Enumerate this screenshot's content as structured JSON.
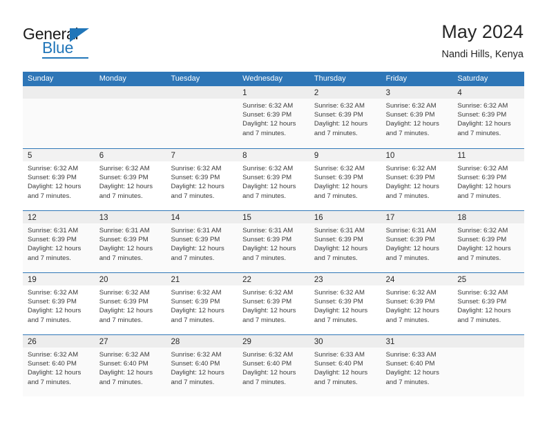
{
  "logo": {
    "word_top": "General",
    "word_bottom": "Blue",
    "triangle_icon": "blue-triangle-icon",
    "accent_color": "#2176b9"
  },
  "header": {
    "title": "May 2024",
    "location": "Nandi Hills, Kenya"
  },
  "calendar": {
    "header_bg": "#2e76b7",
    "day_names": [
      "Sunday",
      "Monday",
      "Tuesday",
      "Wednesday",
      "Thursday",
      "Friday",
      "Saturday"
    ],
    "weeks": [
      [
        {
          "date": "",
          "lines": []
        },
        {
          "date": "",
          "lines": []
        },
        {
          "date": "",
          "lines": []
        },
        {
          "date": "1",
          "lines": [
            "Sunrise: 6:32 AM",
            "Sunset: 6:39 PM",
            "Daylight: 12 hours",
            "and 7 minutes."
          ]
        },
        {
          "date": "2",
          "lines": [
            "Sunrise: 6:32 AM",
            "Sunset: 6:39 PM",
            "Daylight: 12 hours",
            "and 7 minutes."
          ]
        },
        {
          "date": "3",
          "lines": [
            "Sunrise: 6:32 AM",
            "Sunset: 6:39 PM",
            "Daylight: 12 hours",
            "and 7 minutes."
          ]
        },
        {
          "date": "4",
          "lines": [
            "Sunrise: 6:32 AM",
            "Sunset: 6:39 PM",
            "Daylight: 12 hours",
            "and 7 minutes."
          ]
        }
      ],
      [
        {
          "date": "5",
          "lines": [
            "Sunrise: 6:32 AM",
            "Sunset: 6:39 PM",
            "Daylight: 12 hours",
            "and 7 minutes."
          ]
        },
        {
          "date": "6",
          "lines": [
            "Sunrise: 6:32 AM",
            "Sunset: 6:39 PM",
            "Daylight: 12 hours",
            "and 7 minutes."
          ]
        },
        {
          "date": "7",
          "lines": [
            "Sunrise: 6:32 AM",
            "Sunset: 6:39 PM",
            "Daylight: 12 hours",
            "and 7 minutes."
          ]
        },
        {
          "date": "8",
          "lines": [
            "Sunrise: 6:32 AM",
            "Sunset: 6:39 PM",
            "Daylight: 12 hours",
            "and 7 minutes."
          ]
        },
        {
          "date": "9",
          "lines": [
            "Sunrise: 6:32 AM",
            "Sunset: 6:39 PM",
            "Daylight: 12 hours",
            "and 7 minutes."
          ]
        },
        {
          "date": "10",
          "lines": [
            "Sunrise: 6:32 AM",
            "Sunset: 6:39 PM",
            "Daylight: 12 hours",
            "and 7 minutes."
          ]
        },
        {
          "date": "11",
          "lines": [
            "Sunrise: 6:32 AM",
            "Sunset: 6:39 PM",
            "Daylight: 12 hours",
            "and 7 minutes."
          ]
        }
      ],
      [
        {
          "date": "12",
          "lines": [
            "Sunrise: 6:31 AM",
            "Sunset: 6:39 PM",
            "Daylight: 12 hours",
            "and 7 minutes."
          ]
        },
        {
          "date": "13",
          "lines": [
            "Sunrise: 6:31 AM",
            "Sunset: 6:39 PM",
            "Daylight: 12 hours",
            "and 7 minutes."
          ]
        },
        {
          "date": "14",
          "lines": [
            "Sunrise: 6:31 AM",
            "Sunset: 6:39 PM",
            "Daylight: 12 hours",
            "and 7 minutes."
          ]
        },
        {
          "date": "15",
          "lines": [
            "Sunrise: 6:31 AM",
            "Sunset: 6:39 PM",
            "Daylight: 12 hours",
            "and 7 minutes."
          ]
        },
        {
          "date": "16",
          "lines": [
            "Sunrise: 6:31 AM",
            "Sunset: 6:39 PM",
            "Daylight: 12 hours",
            "and 7 minutes."
          ]
        },
        {
          "date": "17",
          "lines": [
            "Sunrise: 6:31 AM",
            "Sunset: 6:39 PM",
            "Daylight: 12 hours",
            "and 7 minutes."
          ]
        },
        {
          "date": "18",
          "lines": [
            "Sunrise: 6:32 AM",
            "Sunset: 6:39 PM",
            "Daylight: 12 hours",
            "and 7 minutes."
          ]
        }
      ],
      [
        {
          "date": "19",
          "lines": [
            "Sunrise: 6:32 AM",
            "Sunset: 6:39 PM",
            "Daylight: 12 hours",
            "and 7 minutes."
          ]
        },
        {
          "date": "20",
          "lines": [
            "Sunrise: 6:32 AM",
            "Sunset: 6:39 PM",
            "Daylight: 12 hours",
            "and 7 minutes."
          ]
        },
        {
          "date": "21",
          "lines": [
            "Sunrise: 6:32 AM",
            "Sunset: 6:39 PM",
            "Daylight: 12 hours",
            "and 7 minutes."
          ]
        },
        {
          "date": "22",
          "lines": [
            "Sunrise: 6:32 AM",
            "Sunset: 6:39 PM",
            "Daylight: 12 hours",
            "and 7 minutes."
          ]
        },
        {
          "date": "23",
          "lines": [
            "Sunrise: 6:32 AM",
            "Sunset: 6:39 PM",
            "Daylight: 12 hours",
            "and 7 minutes."
          ]
        },
        {
          "date": "24",
          "lines": [
            "Sunrise: 6:32 AM",
            "Sunset: 6:39 PM",
            "Daylight: 12 hours",
            "and 7 minutes."
          ]
        },
        {
          "date": "25",
          "lines": [
            "Sunrise: 6:32 AM",
            "Sunset: 6:39 PM",
            "Daylight: 12 hours",
            "and 7 minutes."
          ]
        }
      ],
      [
        {
          "date": "26",
          "lines": [
            "Sunrise: 6:32 AM",
            "Sunset: 6:40 PM",
            "Daylight: 12 hours",
            "and 7 minutes."
          ]
        },
        {
          "date": "27",
          "lines": [
            "Sunrise: 6:32 AM",
            "Sunset: 6:40 PM",
            "Daylight: 12 hours",
            "and 7 minutes."
          ]
        },
        {
          "date": "28",
          "lines": [
            "Sunrise: 6:32 AM",
            "Sunset: 6:40 PM",
            "Daylight: 12 hours",
            "and 7 minutes."
          ]
        },
        {
          "date": "29",
          "lines": [
            "Sunrise: 6:32 AM",
            "Sunset: 6:40 PM",
            "Daylight: 12 hours",
            "and 7 minutes."
          ]
        },
        {
          "date": "30",
          "lines": [
            "Sunrise: 6:33 AM",
            "Sunset: 6:40 PM",
            "Daylight: 12 hours",
            "and 7 minutes."
          ]
        },
        {
          "date": "31",
          "lines": [
            "Sunrise: 6:33 AM",
            "Sunset: 6:40 PM",
            "Daylight: 12 hours",
            "and 7 minutes."
          ]
        },
        {
          "date": "",
          "lines": []
        }
      ]
    ]
  }
}
